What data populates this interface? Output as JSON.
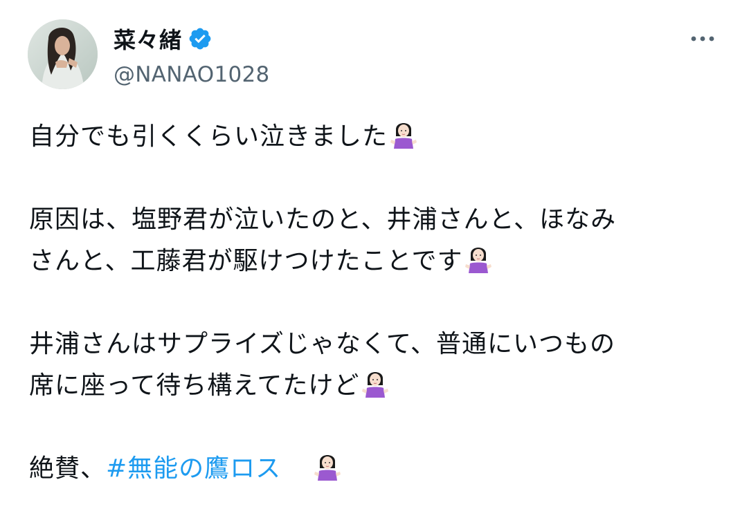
{
  "author": {
    "display_name": "菜々緒",
    "handle": "@NANAO1028",
    "verified": true,
    "verified_color": "#1d9bf0",
    "avatar": "avatar-photo"
  },
  "menu": {
    "icon": "more-options-icon"
  },
  "tweet": {
    "line1": "自分でも引くくらい泣きました",
    "line2": "原因は、塩野君が泣いたのと、井浦さんと、ほなみ",
    "line3": "さんと、工藤君が駆けつけたことです",
    "line4": "井浦さんはサプライズじゃなくて、普通にいつもの",
    "line5": "席に座って待ち構えてたけど",
    "line6_prefix": "絶賛、",
    "hashtag": "#無能の鷹ロス",
    "emoji": "person-shrugging-emoji",
    "hashtag_color": "#1d9bf0"
  }
}
